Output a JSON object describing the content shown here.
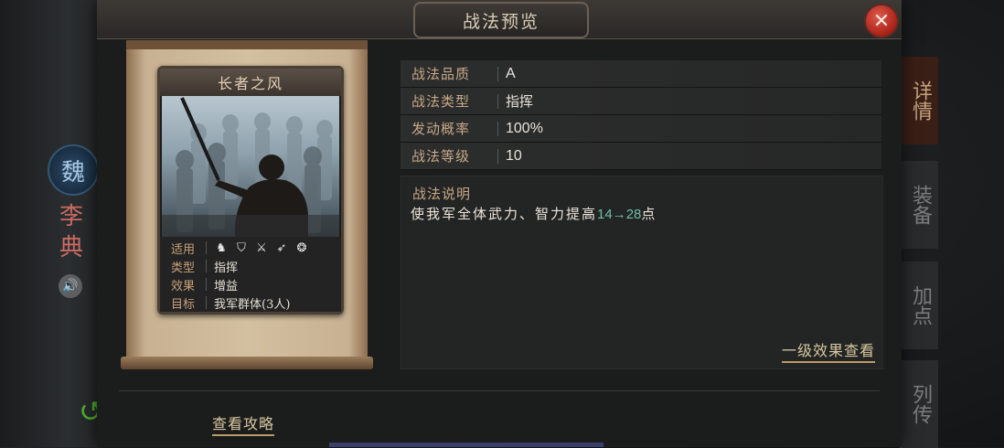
{
  "window": {
    "title": "战法预览"
  },
  "background": {
    "kingdom_badge": "魏",
    "hero_name": "李典"
  },
  "side_tabs": [
    {
      "label": "详情",
      "active": true
    },
    {
      "label": "装备",
      "active": false
    },
    {
      "label": "加点",
      "active": false
    },
    {
      "label": "列传",
      "active": false
    }
  ],
  "card": {
    "title": "长者之风",
    "applicable_label": "适用",
    "troop_icons": [
      "cavalry-icon",
      "shield-icon",
      "bow-icon",
      "spear-icon",
      "siege-wheel-icon"
    ],
    "type_label": "类型",
    "type_value": "指挥",
    "effect_label": "效果",
    "effect_value": "增益",
    "target_label": "目标",
    "target_value": "我军群体(3人)"
  },
  "stats": [
    {
      "label": "战法品质",
      "value": "A"
    },
    {
      "label": "战法类型",
      "value": "指挥"
    },
    {
      "label": "发动概率",
      "value": "100%"
    },
    {
      "label": "战法等级",
      "value": "10"
    }
  ],
  "description": {
    "title": "战法说明",
    "text_prefix": "使我军全体武力、智力提高",
    "highlight": "14→28",
    "text_suffix": "点",
    "level_effect_link": "一级效果查看"
  },
  "footer": {
    "guide_link": "查看攻略"
  },
  "colors": {
    "accent_gold": "#c7a988",
    "highlight_green": "#6fc0a8",
    "close_red": "#c0362a"
  }
}
